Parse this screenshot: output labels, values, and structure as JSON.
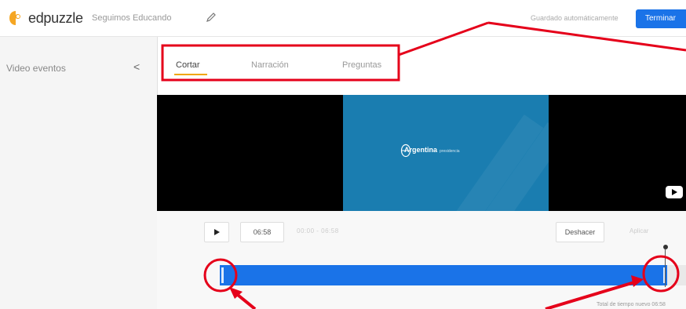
{
  "header": {
    "brand": "edpuzzle",
    "video_title": "Seguimos Educando",
    "autosave_text": "Guardado automáticamente",
    "finish_label": "Terminar"
  },
  "sidebar": {
    "title": "Video eventos",
    "collapse_glyph": "<"
  },
  "tabs": [
    {
      "label": "Cortar",
      "active": true
    },
    {
      "label": "Narración",
      "active": false
    },
    {
      "label": "Preguntas",
      "active": false
    }
  ],
  "video": {
    "thumbnail_brand": "Argentina",
    "thumbnail_sub": "presidencia"
  },
  "controls": {
    "current_time": "06:58",
    "range_text": "00:00 - 06:58",
    "undo_label": "Deshacer",
    "apply_label": "Aplicar"
  },
  "timeline": {
    "selected_fraction": 0.96,
    "total_time_text": "Total de tiempo nuevo 06:58"
  },
  "colors": {
    "accent": "#1a73e8",
    "tab_underline": "#f0a500",
    "annotation": "#e5001a"
  }
}
